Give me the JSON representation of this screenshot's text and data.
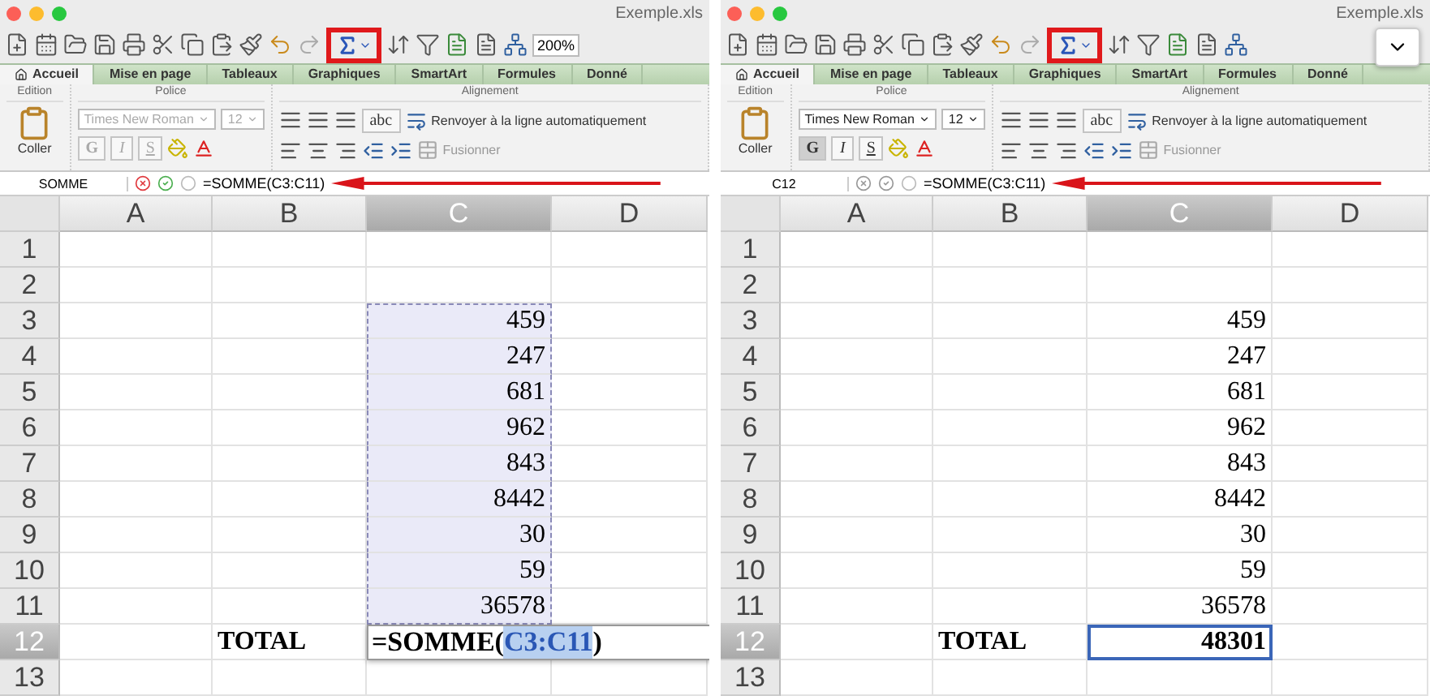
{
  "panels": [
    {
      "title": "Exemple.xls",
      "zoom": "200%",
      "sum_highlighted": true,
      "chevron": false,
      "tabs": [
        {
          "label": "Accueil",
          "selected": true
        },
        {
          "label": "Mise en page",
          "selected": false
        },
        {
          "label": "Tableaux",
          "selected": false
        },
        {
          "label": "Graphiques",
          "selected": false
        },
        {
          "label": "SmartArt",
          "selected": false
        },
        {
          "label": "Formules",
          "selected": false
        },
        {
          "label": "Donné",
          "selected": false
        }
      ],
      "groups": [
        "Edition",
        "Police",
        "Alignement"
      ],
      "paste_label": "Coller",
      "font": {
        "name": "Times New Roman",
        "size": "12",
        "disabled": true
      },
      "style_buttons": [
        "G",
        "I",
        "S"
      ],
      "wrap_button": "abc",
      "wrap_label": "Renvoyer à la ligne automatiquement",
      "merge_label": "Fusionner",
      "name_box": "SOMME",
      "editing": true,
      "formula": "=SOMME(C3:C11)",
      "columns": [
        {
          "label": "A",
          "selected": false
        },
        {
          "label": "B",
          "selected": false
        },
        {
          "label": "C",
          "selected": true
        },
        {
          "label": "D",
          "selected": false
        }
      ],
      "rows": [
        {
          "number": "1",
          "selected": false
        },
        {
          "number": "2",
          "selected": false
        },
        {
          "number": "3",
          "selected": false,
          "c": {
            "kind": "value",
            "text": "459",
            "in_range": true
          }
        },
        {
          "number": "4",
          "selected": false,
          "c": {
            "kind": "value",
            "text": "247",
            "in_range": true
          }
        },
        {
          "number": "5",
          "selected": false,
          "c": {
            "kind": "value",
            "text": "681",
            "in_range": true
          }
        },
        {
          "number": "6",
          "selected": false,
          "c": {
            "kind": "value",
            "text": "962",
            "in_range": true
          }
        },
        {
          "number": "7",
          "selected": false,
          "c": {
            "kind": "value",
            "text": "843",
            "in_range": true
          }
        },
        {
          "number": "8",
          "selected": false,
          "c": {
            "kind": "value",
            "text": "8442",
            "in_range": true
          }
        },
        {
          "number": "9",
          "selected": false,
          "c": {
            "kind": "value",
            "text": "30",
            "in_range": true
          }
        },
        {
          "number": "10",
          "selected": false,
          "c": {
            "kind": "value",
            "text": "59",
            "in_range": true
          }
        },
        {
          "number": "11",
          "selected": false,
          "c": {
            "kind": "value",
            "text": "36578",
            "in_range": true
          }
        },
        {
          "number": "12",
          "selected": true,
          "b": {
            "kind": "label",
            "text": "TOTAL"
          },
          "c": {
            "kind": "editor",
            "parts": [
              "=SOMME(",
              "C3:C11",
              ")"
            ]
          }
        },
        {
          "number": "13",
          "selected": false
        }
      ]
    },
    {
      "title": "Exemple.xls",
      "sum_highlighted": true,
      "chevron": true,
      "tabs": [
        {
          "label": "Accueil",
          "selected": true
        },
        {
          "label": "Mise en page",
          "selected": false
        },
        {
          "label": "Tableaux",
          "selected": false
        },
        {
          "label": "Graphiques",
          "selected": false
        },
        {
          "label": "SmartArt",
          "selected": false
        },
        {
          "label": "Formules",
          "selected": false
        },
        {
          "label": "Donné",
          "selected": false
        }
      ],
      "groups": [
        "Edition",
        "Police",
        "Alignement"
      ],
      "paste_label": "Coller",
      "font": {
        "name": "Times New Roman",
        "size": "12",
        "disabled": false
      },
      "style_buttons": [
        "G",
        "I",
        "S"
      ],
      "wrap_button": "abc",
      "wrap_label": "Renvoyer à la ligne automatiquement",
      "merge_label": "Fusionner",
      "name_box": "C12",
      "editing": false,
      "formula": "=SOMME(C3:C11)",
      "columns": [
        {
          "label": "A",
          "selected": false
        },
        {
          "label": "B",
          "selected": false
        },
        {
          "label": "C",
          "selected": true
        },
        {
          "label": "D",
          "selected": false
        }
      ],
      "rows": [
        {
          "number": "1",
          "selected": false
        },
        {
          "number": "2",
          "selected": false
        },
        {
          "number": "3",
          "selected": false,
          "c": {
            "kind": "value",
            "text": "459",
            "in_range": false
          }
        },
        {
          "number": "4",
          "selected": false,
          "c": {
            "kind": "value",
            "text": "247",
            "in_range": false
          }
        },
        {
          "number": "5",
          "selected": false,
          "c": {
            "kind": "value",
            "text": "681",
            "in_range": false
          }
        },
        {
          "number": "6",
          "selected": false,
          "c": {
            "kind": "value",
            "text": "962",
            "in_range": false
          }
        },
        {
          "number": "7",
          "selected": false,
          "c": {
            "kind": "value",
            "text": "843",
            "in_range": false
          }
        },
        {
          "number": "8",
          "selected": false,
          "c": {
            "kind": "value",
            "text": "8442",
            "in_range": false
          }
        },
        {
          "number": "9",
          "selected": false,
          "c": {
            "kind": "value",
            "text": "30",
            "in_range": false
          }
        },
        {
          "number": "10",
          "selected": false,
          "c": {
            "kind": "value",
            "text": "59",
            "in_range": false
          }
        },
        {
          "number": "11",
          "selected": false,
          "c": {
            "kind": "value",
            "text": "36578",
            "in_range": false
          }
        },
        {
          "number": "12",
          "selected": true,
          "b": {
            "kind": "label",
            "text": "TOTAL"
          },
          "c": {
            "kind": "active",
            "text": "48301"
          }
        },
        {
          "number": "13",
          "selected": false
        }
      ]
    }
  ]
}
